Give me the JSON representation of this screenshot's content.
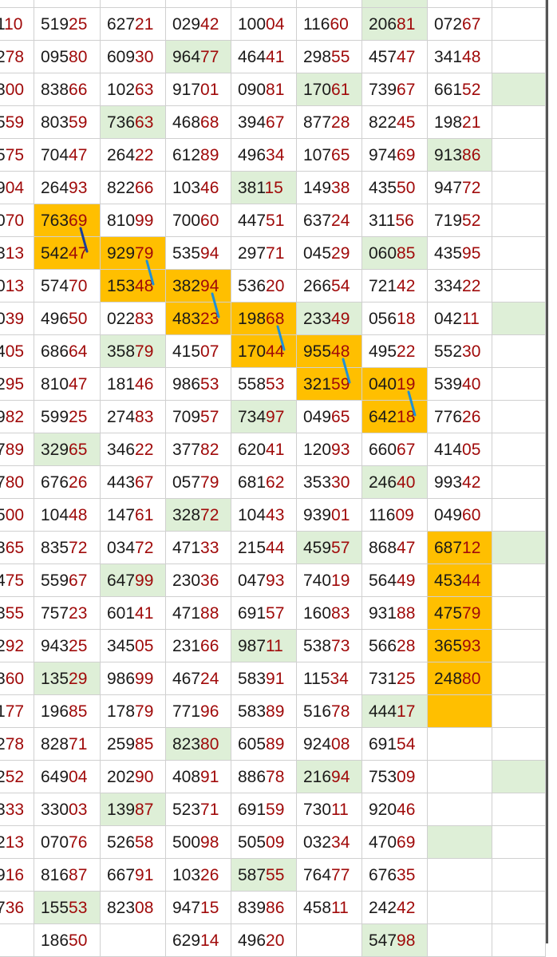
{
  "colors": {
    "highlight": "#deefd7",
    "hot": "#ffbf00",
    "text": "#1a1a1a",
    "suffix": "#a00a0a",
    "link": "#1e90d8"
  },
  "rows": [
    [
      "110",
      "51925",
      "62721",
      "02942",
      "10004",
      "11660",
      "20681",
      "07267",
      ""
    ],
    [
      "278",
      "09580",
      "60930",
      "96477",
      "46441",
      "29855",
      "45747",
      "34148",
      ""
    ],
    [
      "300",
      "83866",
      "10263",
      "91701",
      "09081",
      "17061",
      "73967",
      "66152",
      ""
    ],
    [
      "559",
      "80359",
      "73663",
      "46868",
      "39467",
      "87728",
      "82245",
      "19821",
      ""
    ],
    [
      "575",
      "70447",
      "26422",
      "61289",
      "49634",
      "10765",
      "97469",
      "91386",
      ""
    ],
    [
      "904",
      "26493",
      "82266",
      "10346",
      "38115",
      "14938",
      "43550",
      "94772",
      ""
    ],
    [
      "070",
      "76369",
      "81099",
      "70060",
      "44751",
      "63724",
      "31156",
      "71952",
      ""
    ],
    [
      "313",
      "54247",
      "92979",
      "53594",
      "29771",
      "04529",
      "06085",
      "43595",
      ""
    ],
    [
      "013",
      "57470",
      "15348",
      "38294",
      "53620",
      "26654",
      "72142",
      "33422",
      ""
    ],
    [
      "039",
      "49650",
      "02283",
      "48323",
      "19868",
      "23349",
      "05618",
      "04211",
      ""
    ],
    [
      "405",
      "68664",
      "35879",
      "41507",
      "17044",
      "95548",
      "49522",
      "55230",
      ""
    ],
    [
      "295",
      "81047",
      "18146",
      "98653",
      "55853",
      "32159",
      "04019",
      "53940",
      ""
    ],
    [
      "982",
      "59925",
      "27483",
      "70957",
      "73497",
      "04965",
      "64218",
      "77626",
      ""
    ],
    [
      "789",
      "32965",
      "34622",
      "37782",
      "62041",
      "12093",
      "66067",
      "41405",
      ""
    ],
    [
      "780",
      "67626",
      "44367",
      "05779",
      "68162",
      "35330",
      "24640",
      "99342",
      ""
    ],
    [
      "500",
      "10448",
      "14761",
      "32872",
      "10443",
      "93901",
      "11609",
      "04960",
      ""
    ],
    [
      "365",
      "83572",
      "03472",
      "47133",
      "21544",
      "45957",
      "86847",
      "68712",
      ""
    ],
    [
      "475",
      "55967",
      "64799",
      "23036",
      "04793",
      "74019",
      "56449",
      "45344",
      ""
    ],
    [
      "355",
      "75723",
      "60141",
      "47188",
      "69157",
      "16083",
      "93188",
      "47579",
      ""
    ],
    [
      "292",
      "94325",
      "34505",
      "23166",
      "98711",
      "53873",
      "56628",
      "36593",
      ""
    ],
    [
      "360",
      "13529",
      "98699",
      "46724",
      "58391",
      "11534",
      "73125",
      "24880",
      ""
    ],
    [
      "177",
      "19685",
      "17879",
      "77196",
      "58389",
      "51678",
      "44417",
      "",
      ""
    ],
    [
      "278",
      "82871",
      "25985",
      "82380",
      "60589",
      "92408",
      "69154",
      "",
      ""
    ],
    [
      "252",
      "64904",
      "20290",
      "40891",
      "88678",
      "21694",
      "75309",
      "",
      ""
    ],
    [
      "333",
      "33003",
      "13987",
      "52371",
      "69159",
      "73011",
      "92046",
      "",
      ""
    ],
    [
      "213",
      "07076",
      "52658",
      "50098",
      "50509",
      "03234",
      "47069",
      "",
      ""
    ],
    [
      "916",
      "81687",
      "66791",
      "10326",
      "58755",
      "76477",
      "67635",
      "",
      ""
    ],
    [
      "736",
      "15553",
      "82308",
      "94715",
      "83986",
      "45811",
      "24242",
      "",
      ""
    ],
    [
      "",
      "18650",
      "",
      "62914",
      "49620",
      "",
      "54798",
      "",
      ""
    ]
  ],
  "highlight": [
    [
      0,
      6
    ],
    [
      1,
      3
    ],
    [
      2,
      5
    ],
    [
      2,
      8
    ],
    [
      3,
      2
    ],
    [
      4,
      7
    ],
    [
      5,
      4
    ],
    [
      7,
      6
    ],
    [
      9,
      5
    ],
    [
      9,
      8
    ],
    [
      10,
      2
    ],
    [
      12,
      4
    ],
    [
      13,
      1
    ],
    [
      14,
      6
    ],
    [
      15,
      3
    ],
    [
      16,
      5
    ],
    [
      16,
      8
    ],
    [
      17,
      2
    ],
    [
      19,
      4
    ],
    [
      20,
      1
    ],
    [
      21,
      6
    ],
    [
      22,
      3
    ],
    [
      23,
      5
    ],
    [
      23,
      8
    ],
    [
      24,
      2
    ],
    [
      25,
      7
    ],
    [
      26,
      4
    ],
    [
      27,
      1
    ],
    [
      28,
      6
    ]
  ],
  "hot": [
    [
      6,
      1
    ],
    [
      7,
      1
    ],
    [
      7,
      2
    ],
    [
      8,
      2
    ],
    [
      8,
      3
    ],
    [
      9,
      3
    ],
    [
      9,
      4
    ],
    [
      10,
      4
    ],
    [
      10,
      5
    ],
    [
      11,
      5
    ],
    [
      11,
      6
    ],
    [
      12,
      6
    ],
    [
      16,
      7
    ],
    [
      17,
      7
    ],
    [
      18,
      7
    ],
    [
      19,
      7
    ],
    [
      20,
      7
    ],
    [
      21,
      7
    ]
  ],
  "links": [
    [
      [
        6,
        1
      ],
      [
        7,
        1
      ]
    ],
    [
      [
        7,
        2
      ],
      [
        8,
        2
      ]
    ],
    [
      [
        8,
        3
      ],
      [
        9,
        3
      ]
    ],
    [
      [
        9,
        4
      ],
      [
        10,
        4
      ]
    ],
    [
      [
        10,
        5
      ],
      [
        11,
        5
      ]
    ],
    [
      [
        11,
        6
      ],
      [
        12,
        6
      ]
    ]
  ]
}
